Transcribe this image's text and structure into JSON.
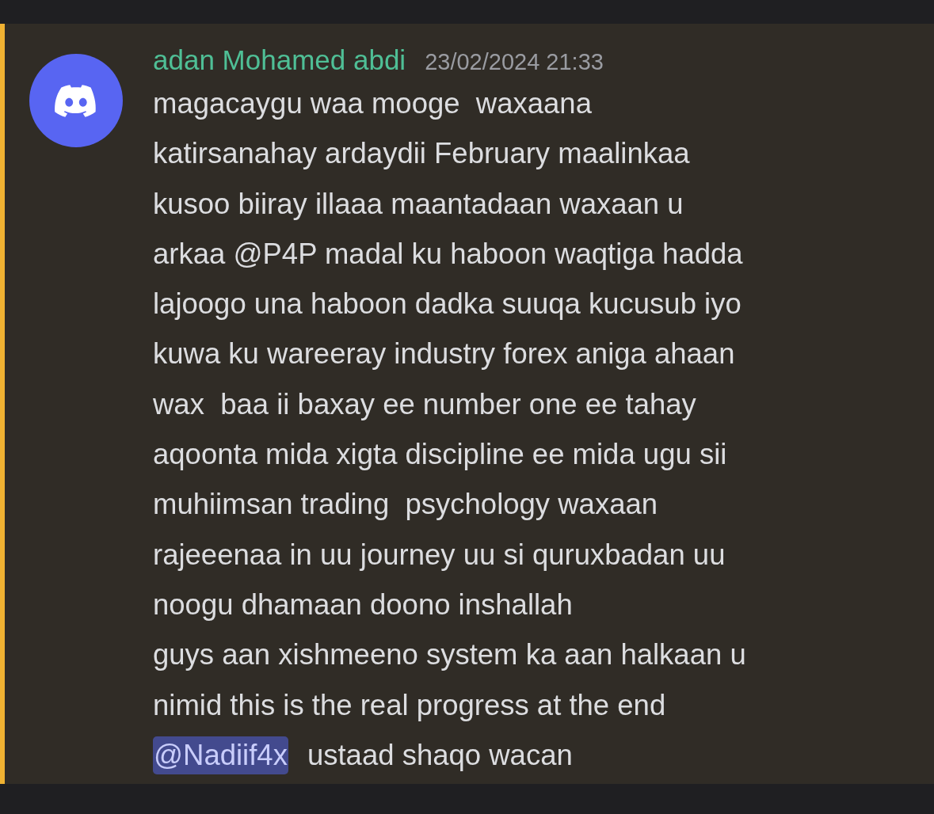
{
  "message": {
    "author": "adan Mohamed abdi",
    "timestamp": "23/02/2024 21:33",
    "highlighted": true,
    "lines": [
      "magacaygu waa mooge  waxaana",
      "katirsanahay ardaydii February maalinkaa",
      "kusoo biiray illaaa maantadaan waxaan u",
      "arkaa @P4P madal ku haboon waqtiga hadda",
      "lajoogo una haboon dadka suuqa kucusub iyo",
      "kuwa ku wareeray industry forex aniga ahaan",
      "wax  baa ii baxay ee number one ee tahay",
      "aqoonta mida xigta discipline ee mida ugu sii",
      "muhiimsan trading  psychology waxaan",
      "rajeeenaa in uu journey uu si quruxbadan uu",
      "noogu dhamaan doono inshallah",
      "guys aan xishmeeno system ka aan halkaan u",
      "nimid this is the real progress at the end"
    ],
    "mention": "@Nadiif4x",
    "last_text": "ustaad shaqo wacan"
  }
}
